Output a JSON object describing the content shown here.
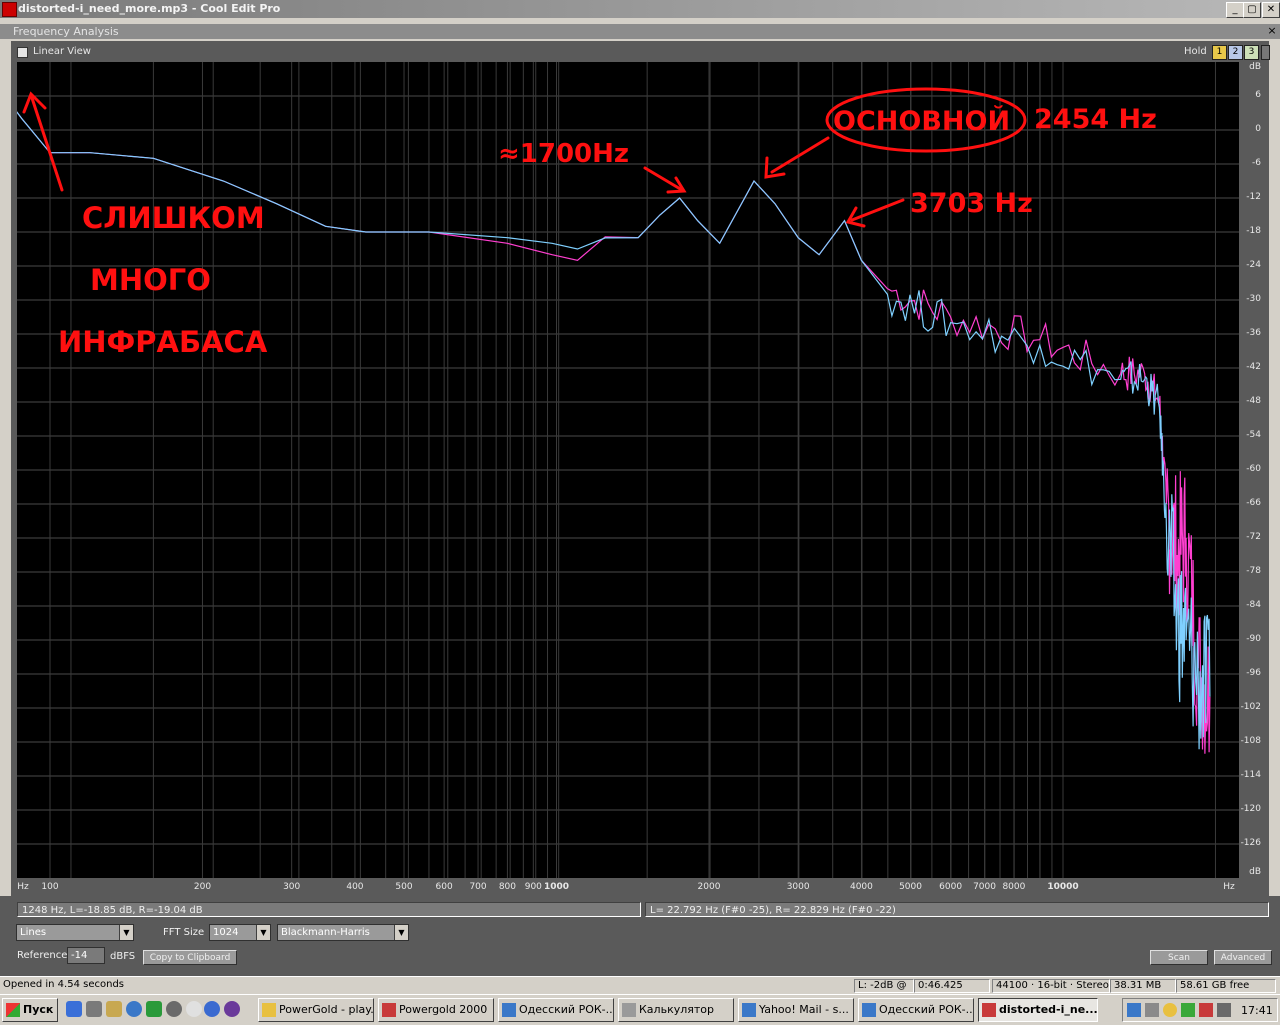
{
  "window": {
    "title": "distorted-i_need_more.mp3 - Cool Edit Pro",
    "buttons": [
      "_",
      "▢",
      "✕"
    ]
  },
  "panel": {
    "title": "Frequency Analysis",
    "close": "×"
  },
  "top_strip": {
    "linear_view_label": "Linear View",
    "hold_label": "Hold",
    "hold_buttons": [
      "1",
      "2",
      "3"
    ]
  },
  "chart_data": {
    "type": "line",
    "x_scale": "log",
    "x_unit_label": "Hz",
    "y_unit_label": "dB",
    "ylim": [
      -132,
      12
    ],
    "y_ticks": [
      "dB",
      "6",
      "0",
      "-6",
      "-12",
      "-18",
      "-24",
      "-30",
      "-36",
      "-42",
      "-48",
      "-54",
      "-60",
      "-66",
      "-72",
      "-78",
      "-84",
      "-90",
      "-96",
      "-102",
      "-108",
      "-114",
      "-120",
      "-126",
      "dB"
    ],
    "x_ticks": [
      "Hz",
      "100",
      "200",
      "300",
      "400",
      "500",
      "600",
      "700",
      "800",
      "900",
      "1000",
      "2000",
      "3000",
      "4000",
      "5000",
      "6000",
      "7000",
      "8000",
      "10000",
      "Hz"
    ],
    "grid": true,
    "series": [
      {
        "color": "#ff3fd0",
        "points": [
          [
            80,
            9
          ],
          [
            83,
            5
          ],
          [
            88,
            2
          ],
          [
            100,
            -4
          ],
          [
            120,
            -4
          ],
          [
            160,
            -5
          ],
          [
            220,
            -9
          ],
          [
            280,
            -13
          ],
          [
            350,
            -17
          ],
          [
            420,
            -18
          ],
          [
            560,
            -18
          ],
          [
            800,
            -20
          ],
          [
            980,
            -22
          ],
          [
            1100,
            -23
          ],
          [
            1248,
            -18.85
          ],
          [
            1450,
            -19
          ],
          [
            1600,
            -15
          ],
          [
            1750,
            -12
          ],
          [
            1900,
            -16
          ],
          [
            2100,
            -20
          ],
          [
            2454,
            -9
          ],
          [
            2700,
            -13
          ],
          [
            3000,
            -19
          ],
          [
            3300,
            -22
          ],
          [
            3703,
            -16
          ],
          [
            4000,
            -23
          ],
          [
            4500,
            -28
          ],
          [
            6000,
            -33
          ],
          [
            9000,
            -37
          ],
          [
            13000,
            -43
          ],
          [
            14500,
            -43
          ],
          [
            15500,
            -48
          ],
          [
            16000,
            -66
          ],
          [
            16800,
            -75
          ],
          [
            17500,
            -72
          ],
          [
            18500,
            -95
          ],
          [
            19500,
            -100
          ]
        ]
      },
      {
        "color": "#7fd0ff",
        "points": [
          [
            80,
            9
          ],
          [
            83,
            5
          ],
          [
            88,
            2
          ],
          [
            100,
            -4
          ],
          [
            120,
            -4
          ],
          [
            160,
            -5
          ],
          [
            220,
            -9
          ],
          [
            280,
            -13
          ],
          [
            350,
            -17
          ],
          [
            420,
            -18
          ],
          [
            560,
            -18
          ],
          [
            800,
            -19
          ],
          [
            980,
            -20
          ],
          [
            1100,
            -21
          ],
          [
            1248,
            -19.04
          ],
          [
            1450,
            -19
          ],
          [
            1600,
            -15
          ],
          [
            1750,
            -12
          ],
          [
            1900,
            -16
          ],
          [
            2100,
            -20
          ],
          [
            2454,
            -9
          ],
          [
            2700,
            -13
          ],
          [
            3000,
            -19
          ],
          [
            3300,
            -22
          ],
          [
            3703,
            -16
          ],
          [
            4000,
            -23
          ],
          [
            4500,
            -29
          ],
          [
            6000,
            -34
          ],
          [
            9000,
            -38
          ],
          [
            13000,
            -44
          ],
          [
            14500,
            -44
          ],
          [
            15500,
            -49
          ],
          [
            16000,
            -70
          ],
          [
            16800,
            -86
          ],
          [
            17500,
            -90
          ],
          [
            18500,
            -97
          ],
          [
            19500,
            -100
          ]
        ]
      }
    ]
  },
  "annotations": {
    "infrabass_line1": "СЛИШКОМ",
    "infrabass_line2": "МНОГО",
    "infrabass_line3": "ИНФРАБАСА",
    "peak1700": "≈1700Hz",
    "main_word": "ОСНОВНОЙ",
    "main_freq": "2454 Hz",
    "peak3703": "3703 Hz"
  },
  "readouts": {
    "cursor": "1248 Hz, L=-18.85 dB, R=-19.04 dB",
    "peak": "L= 22.792 Hz (F#0 -25), R= 22.829 Hz (F#0 -22)"
  },
  "controls": {
    "display_mode": "Lines",
    "fft_size_label": "FFT Size",
    "fft_size": "1024",
    "window_fn": "Blackmann-Harris",
    "reference_label": "Reference",
    "reference_value": "-14",
    "dbfs_label": "dBFS",
    "copy_button": "Copy to Clipboard",
    "scan_button": "Scan",
    "advanced_button": "Advanced"
  },
  "statusbar": {
    "message": "Opened in 4.54 seconds",
    "level": "L: -2dB @",
    "time": "0:46.425",
    "format": "44100 · 16-bit · Stereo",
    "file_size": "38.31 MB",
    "free_space": "58.61 GB free"
  },
  "taskbar": {
    "start": "Пуск",
    "tasks": [
      "PowerGold - play...",
      "Powergold 2000",
      "Одесский РОК-...",
      "Калькулятор",
      "Yahoo! Mail - s...",
      "Одесский РОК-...",
      "distorted-i_ne..."
    ],
    "active_task": 6,
    "clock": "17:41"
  }
}
